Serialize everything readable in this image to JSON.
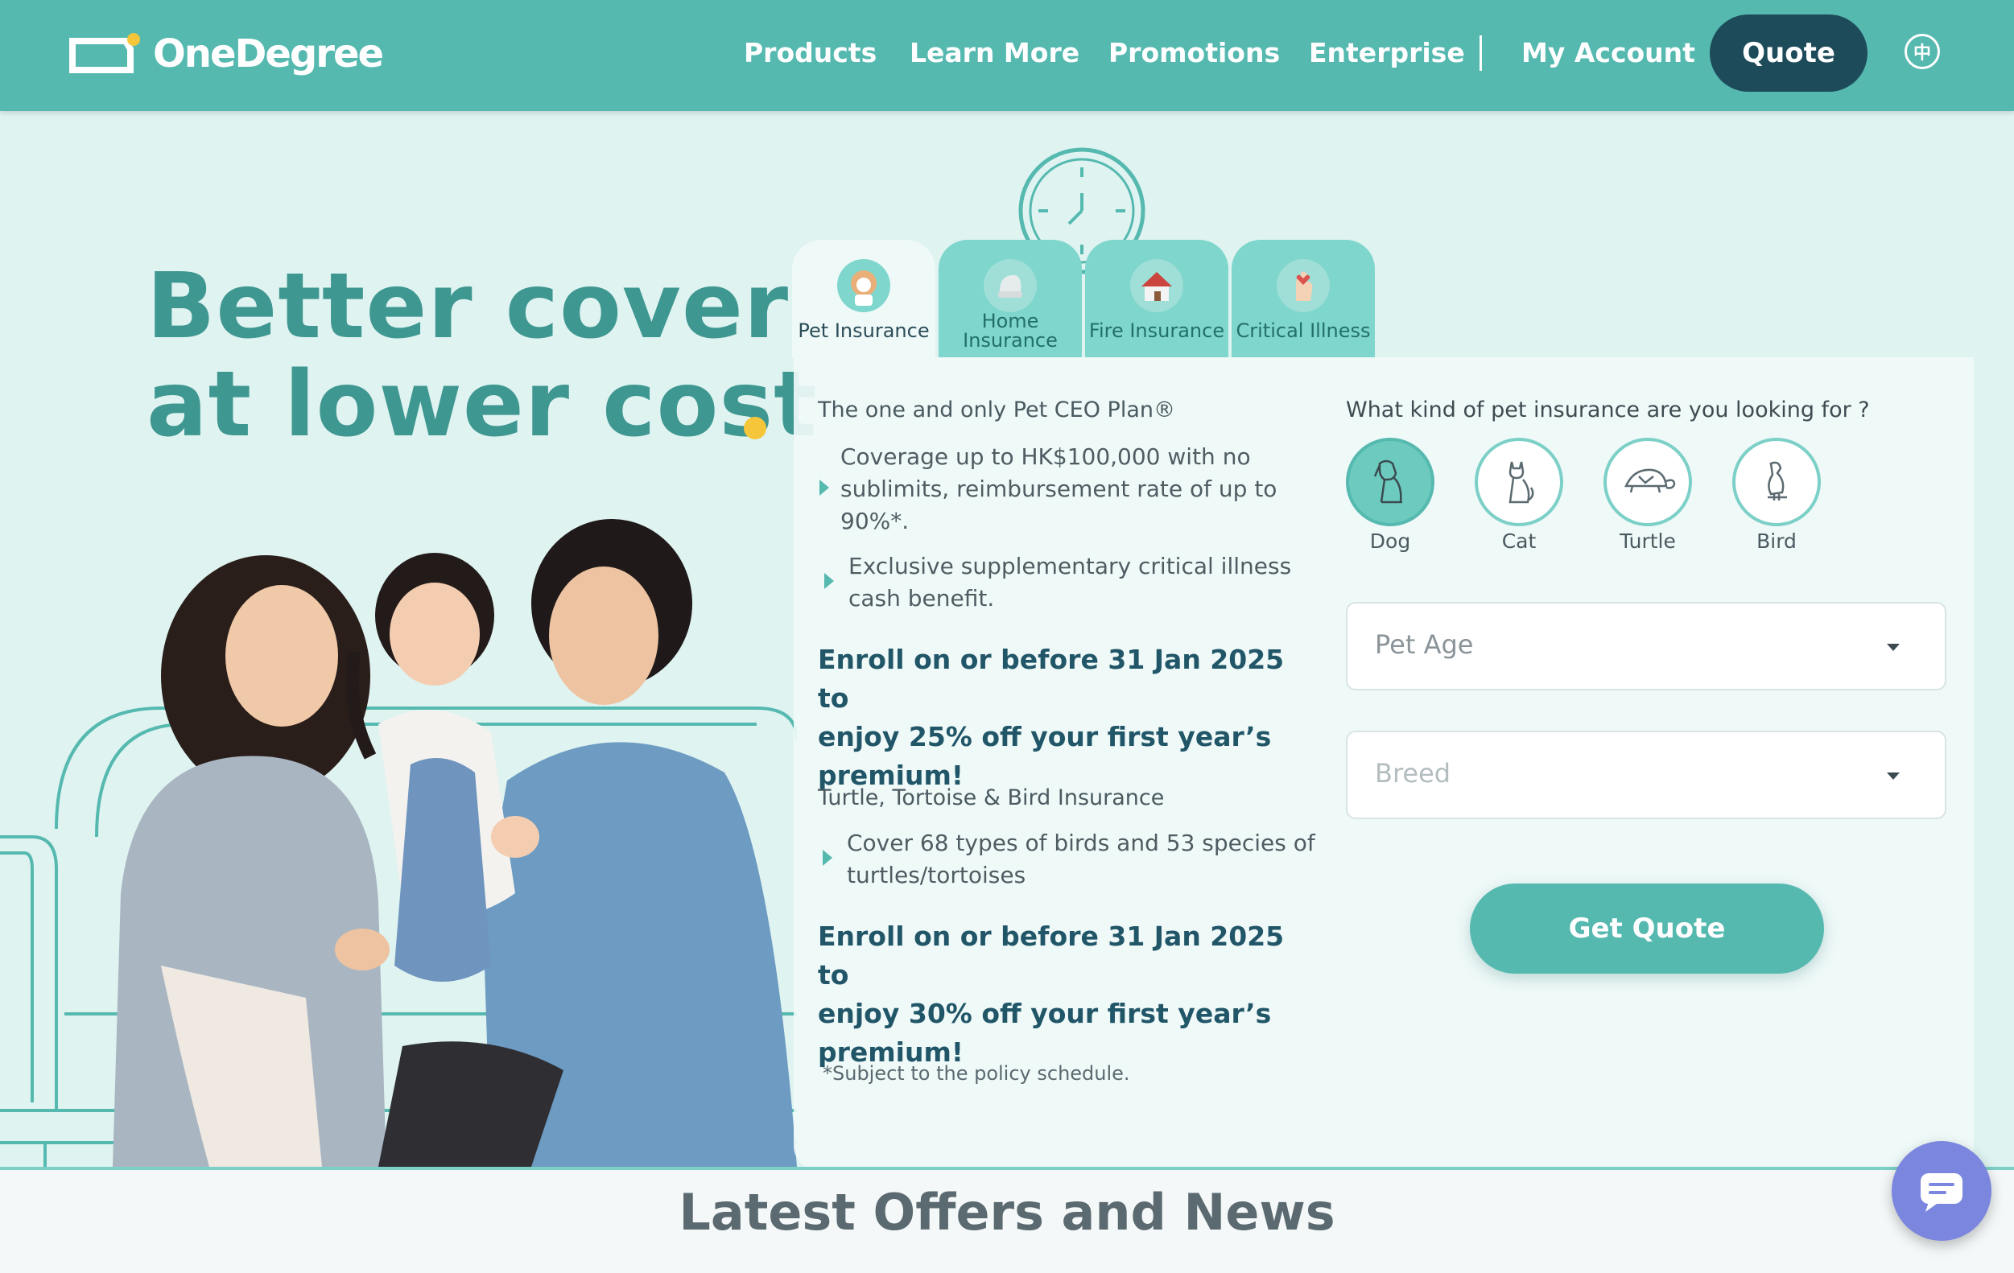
{
  "header": {
    "logo_text": "OneDegree",
    "nav": [
      "Products",
      "Learn More",
      "Promotions",
      "Enterprise",
      "My Account"
    ],
    "quote_label": "Quote",
    "lang_label": "中"
  },
  "hero": {
    "title_line1": "Better cover",
    "title_line2": "at lower cost"
  },
  "tabs": [
    {
      "label": "Pet Insurance",
      "active": true
    },
    {
      "label_line1": "Home",
      "label_line2": "Insurance"
    },
    {
      "label": "Fire Insurance"
    },
    {
      "label": "Critical Illness"
    }
  ],
  "pet_info": {
    "plan_heading": "The one and only Pet CEO Plan®",
    "bullets": [
      [
        "Coverage up to HK$100,000 with no",
        "sublimits, reimbursement rate of up to",
        "90%*."
      ],
      [
        "Exclusive supplementary critical illness",
        "cash benefit."
      ]
    ],
    "promo1": [
      "Enroll on or before 31 Jan 2025 to",
      "enjoy 25% off your first year’s",
      "premium!"
    ],
    "section2_heading": "Turtle, Tortoise & Bird Insurance",
    "bullets2": [
      [
        "Cover 68 types of birds and 53 species of",
        "turtles/tortoises"
      ]
    ],
    "promo2": [
      "Enroll on or before 31 Jan 2025 to",
      "enjoy 30% off your first year’s",
      "premium!"
    ],
    "footnote": "*Subject to the policy schedule."
  },
  "form": {
    "question": "What kind of pet insurance are you looking for ?",
    "pets": [
      "Dog",
      "Cat",
      "Turtle",
      "Bird"
    ],
    "selected_pet": "Dog",
    "pet_age_placeholder": "Pet Age",
    "breed_placeholder": "Breed",
    "submit_label": "Get Quote"
  },
  "news": {
    "heading": "Latest Offers and News"
  },
  "colors": {
    "primary": "#55b9b0",
    "dark": "#1e4b5a",
    "accent": "#f5c63a",
    "chat": "#7b86df"
  }
}
